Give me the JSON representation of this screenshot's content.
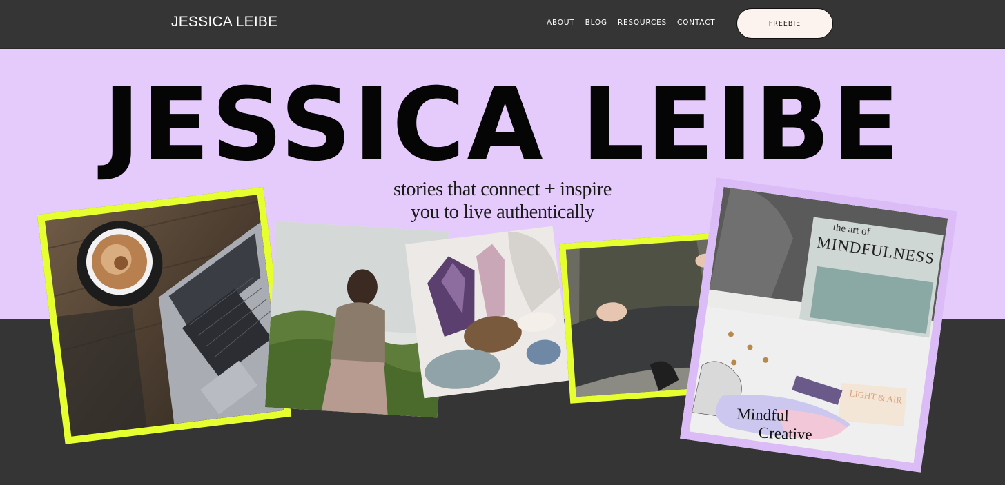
{
  "header": {
    "logo": "JESSICA LEIBE",
    "nav": [
      "ABOUT",
      "BLOG",
      "RESOURCES",
      "CONTACT"
    ],
    "cta": "FREEBIE"
  },
  "hero": {
    "title": "JESSICA LEIBE",
    "tagline_line1": "stories that connect + inspire",
    "tagline_line2": "you to live authentically"
  },
  "photo_text": {
    "book_line1": "the art of",
    "book_line2": "MINDFULNESS",
    "sticker_line1": "Mindful",
    "sticker_line2": "Creative",
    "note": "LIGHT & AIR"
  },
  "colors": {
    "dark_bg": "#353535",
    "hero_band": "#e5cbfb",
    "accent_yellow": "#e6ff2e",
    "lavender_frame": "#dbbcf7",
    "cta_bg": "#fdf3ee"
  }
}
